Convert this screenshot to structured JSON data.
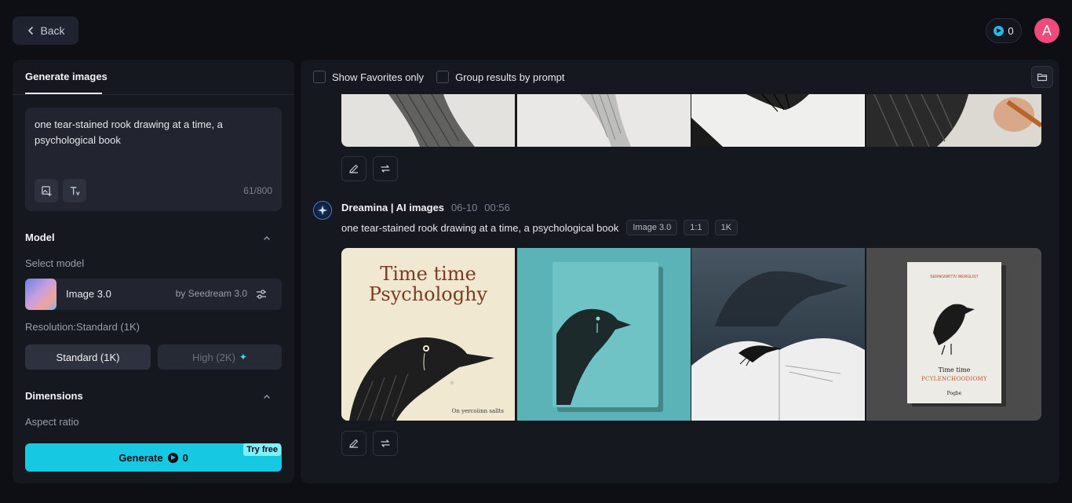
{
  "topbar": {
    "back_label": "Back",
    "credits": "0",
    "avatar_letter": "A"
  },
  "left_panel": {
    "tab_label": "Generate images",
    "prompt_text": "one tear-stained rook drawing at a time, a psychological book",
    "char_count": "61/800",
    "model_section": "Model",
    "select_model_label": "Select model",
    "model_name": "Image 3.0",
    "model_by": "by Seedream 3.0",
    "resolution_label": "Resolution:Standard (1K)",
    "res_standard": "Standard (1K)",
    "res_high": "High (2K)",
    "dimensions_section": "Dimensions",
    "aspect_ratio_label": "Aspect ratio",
    "generate_label": "Generate",
    "generate_credits": "0",
    "try_free": "Try free"
  },
  "right_panel": {
    "filter_favorites": "Show Favorites only",
    "filter_group": "Group results by prompt",
    "generation": {
      "source": "Dreamina | AI images",
      "date": "06-10",
      "time": "00:56",
      "prompt": "one tear-stained rook drawing at a time, a psychological book",
      "tags": [
        "Image 3.0",
        "1:1",
        "1K"
      ]
    },
    "book_cover_1": {
      "title_line1": "Time time",
      "title_line2": "Psychologhy",
      "caption": "On yercoiinn sallts"
    },
    "book_cover_4": {
      "small_text": "SERNGNIKTIV WERGLIST",
      "title": "Time time",
      "subtitle": "PCYLENCHOODIOMY",
      "publisher": "Pogbe"
    }
  },
  "colors": {
    "accent": "#17c8e3",
    "avatar": "#ee4a7b",
    "background": "#0e0f14",
    "panel": "#16181f"
  },
  "icons": [
    "chevron-left-icon",
    "credit-icon",
    "image-upload-icon",
    "text-style-icon",
    "chevron-up-icon",
    "settings-sliders-icon",
    "sparkle-icon",
    "folder-icon",
    "edit-icon",
    "regenerate-icon",
    "dreamina-logo-icon"
  ]
}
